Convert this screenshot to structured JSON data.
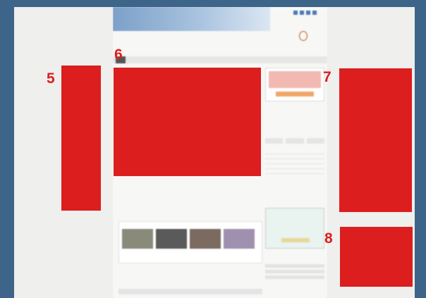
{
  "annotations": {
    "box5": {
      "label": "5"
    },
    "box6": {
      "label": "6"
    },
    "box7": {
      "label": "7"
    },
    "box8": {
      "label": "8"
    }
  },
  "colors": {
    "page_background": "#3d6489",
    "annotation_red": "#dc1e1e"
  }
}
